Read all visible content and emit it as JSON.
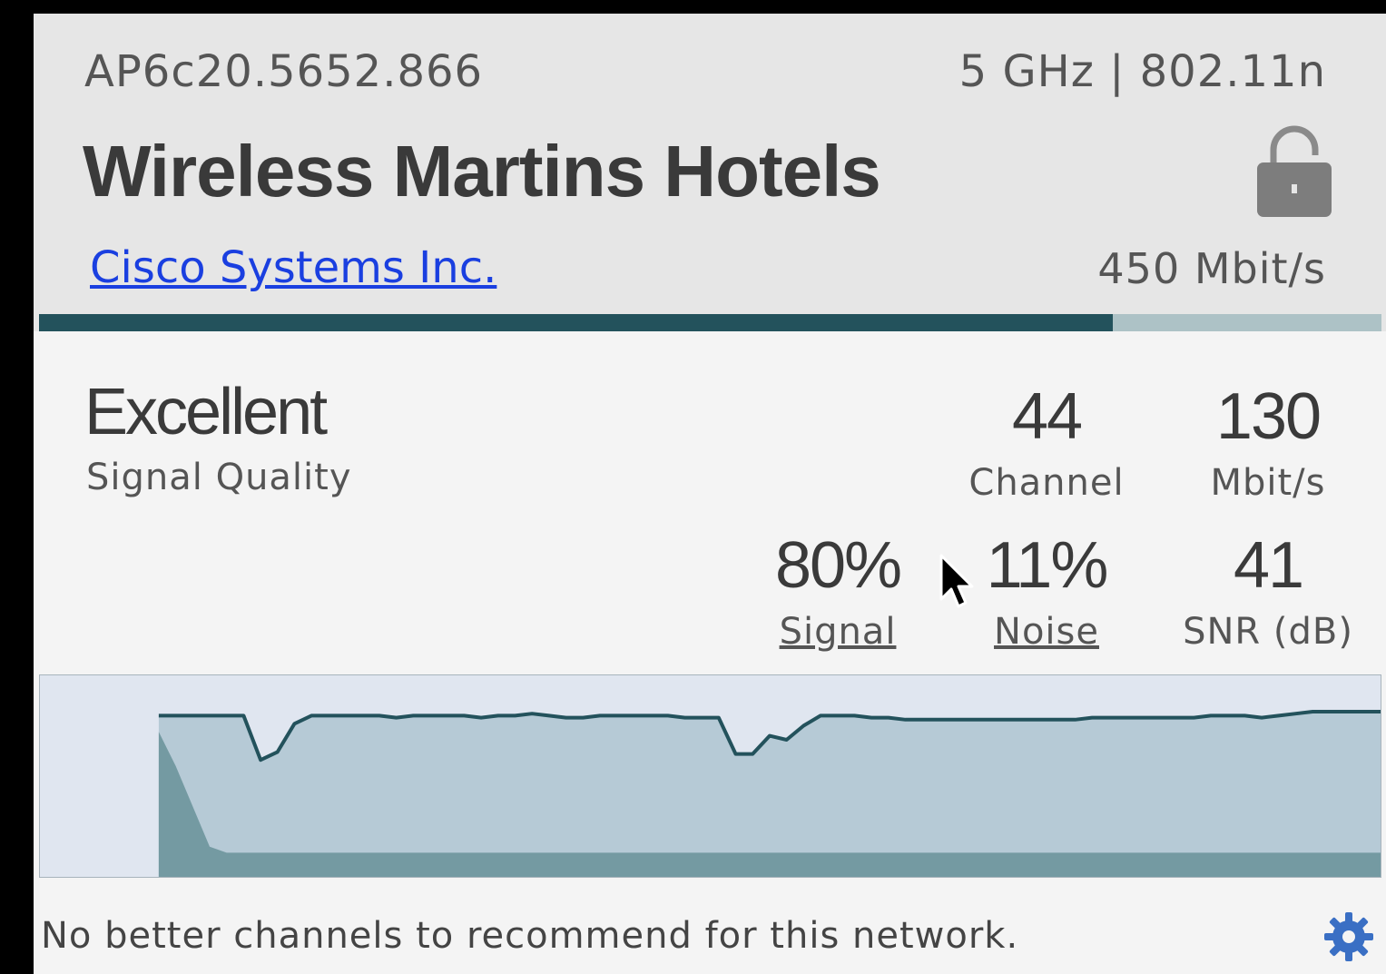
{
  "network": {
    "bssid": "AP6c20.5652.866",
    "band_mode": "5 GHz | 802.11n",
    "ssid": "Wireless Martins Hotels",
    "vendor": "Cisco Systems Inc.",
    "max_rate": "450 Mbit/s",
    "secured": true,
    "lock_icon": "lock-icon"
  },
  "rate_bar": {
    "fraction": 0.8,
    "fill_color": "#23525c",
    "track_color": "#adc2c6"
  },
  "stats": {
    "quality": {
      "value": "Excellent",
      "label": "Signal Quality"
    },
    "channel": {
      "value": "44",
      "label": "Channel"
    },
    "rate": {
      "value": "130",
      "label": "Mbit/s"
    },
    "signal": {
      "value": "80%",
      "label": "Signal"
    },
    "noise": {
      "value": "11%",
      "label": "Noise"
    },
    "snr": {
      "value": "41",
      "label": "SNR (dB)"
    }
  },
  "chart_data": {
    "type": "area",
    "title": "",
    "xlabel": "",
    "ylabel": "",
    "ylim": [
      0,
      100
    ],
    "x": [
      0,
      1,
      2,
      3,
      4,
      5,
      6,
      7,
      8,
      9,
      10,
      11,
      12,
      13,
      14,
      15,
      16,
      17,
      18,
      19,
      20,
      21,
      22,
      23,
      24,
      25,
      26,
      27,
      28,
      29,
      30,
      31,
      32,
      33,
      34,
      35,
      36,
      37,
      38,
      39,
      40,
      41,
      42,
      43,
      44,
      45,
      46,
      47,
      48,
      49,
      50,
      51,
      52,
      53,
      54,
      55,
      56,
      57,
      58,
      59,
      60,
      61,
      62,
      63,
      64,
      65,
      66,
      67,
      68,
      69,
      70,
      71,
      72,
      73,
      74,
      75,
      76,
      77,
      78,
      79
    ],
    "series": [
      {
        "values": [
          null,
          null,
          null,
          null,
          null,
          null,
          null,
          80,
          80,
          80,
          80,
          80,
          80,
          58,
          62,
          76,
          80,
          80,
          80,
          80,
          80,
          79,
          80,
          80,
          80,
          80,
          79,
          80,
          80,
          81,
          80,
          79,
          79,
          80,
          80,
          80,
          80,
          80,
          79,
          79,
          79,
          61,
          61,
          70,
          68,
          75,
          80,
          80,
          80,
          79,
          79,
          78,
          78,
          78,
          78,
          78,
          78,
          78,
          78,
          78,
          78,
          78,
          79,
          79,
          79,
          79,
          79,
          79,
          79,
          80,
          80,
          80,
          79,
          80,
          81,
          82,
          82,
          82,
          82,
          82
        ],
        "color": "#23525c"
      },
      {
        "values": [
          null,
          null,
          null,
          null,
          null,
          null,
          null,
          72,
          55,
          35,
          15,
          12,
          12,
          12,
          12,
          12,
          12,
          12,
          12,
          12,
          12,
          12,
          12,
          12,
          12,
          12,
          12,
          12,
          12,
          12,
          12,
          12,
          12,
          12,
          12,
          12,
          12,
          12,
          12,
          12,
          12,
          12,
          12,
          12,
          12,
          12,
          12,
          12,
          12,
          12,
          12,
          12,
          12,
          12,
          12,
          12,
          12,
          12,
          12,
          12,
          12,
          12,
          12,
          12,
          12,
          12,
          12,
          12,
          12,
          12,
          12,
          12,
          12,
          12,
          12,
          12,
          12,
          12,
          12,
          12
        ],
        "color": "#749aa2"
      }
    ],
    "grid": false
  },
  "footer": {
    "message": "No better channels to recommend for this network.",
    "settings_icon": "gear-icon"
  }
}
